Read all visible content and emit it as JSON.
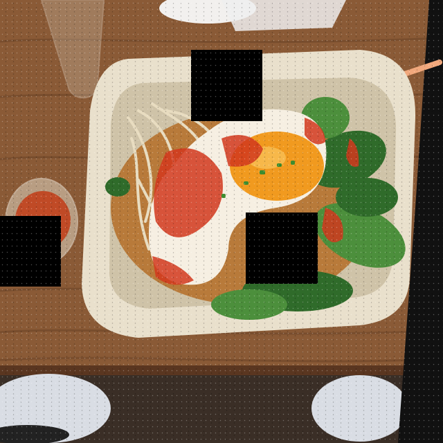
{
  "photo": {
    "subject": "bibimbap-bowl",
    "palette": {
      "table": "#8a5a36",
      "table_dark": "#6b4326",
      "bowl": "#e9e0cc",
      "bowl_shadow": "#cfc3a8",
      "spinach": "#2f6b2a",
      "spinach_light": "#4c8f3c",
      "egg_white": "#f6efe2",
      "yolk": "#f19a1f",
      "sauce": "#d2381d",
      "sprouts": "#e8dcc0",
      "rice": "#b87a3a",
      "floor": "#d9dde4",
      "occluder": "#000000"
    }
  }
}
